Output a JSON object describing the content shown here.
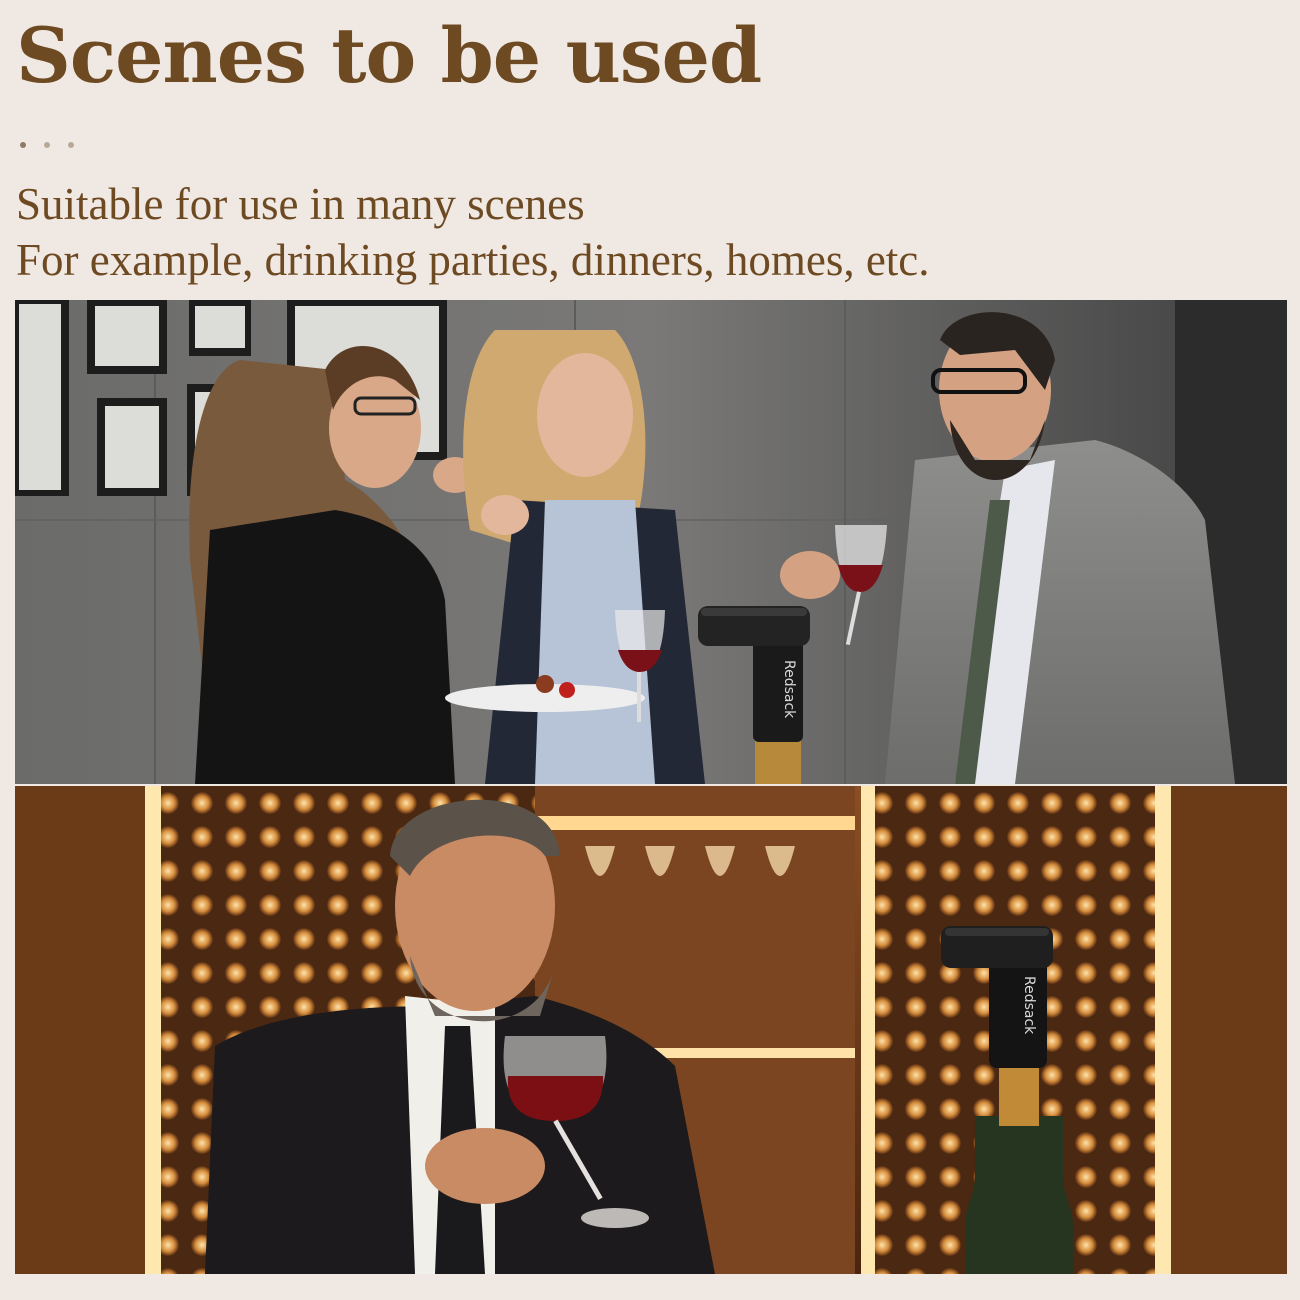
{
  "header": {
    "title": "Scenes to be used",
    "lines": [
      "Suitable for use in many scenes",
      "For example, drinking parties, dinners, homes, etc."
    ],
    "indicator_dots": 3
  },
  "scenes": [
    {
      "brand_label": "Redsack"
    },
    {
      "brand_label": "Redsack"
    }
  ],
  "colors": {
    "background": "#f0e9e3",
    "accent_text": "#6e4a23"
  }
}
